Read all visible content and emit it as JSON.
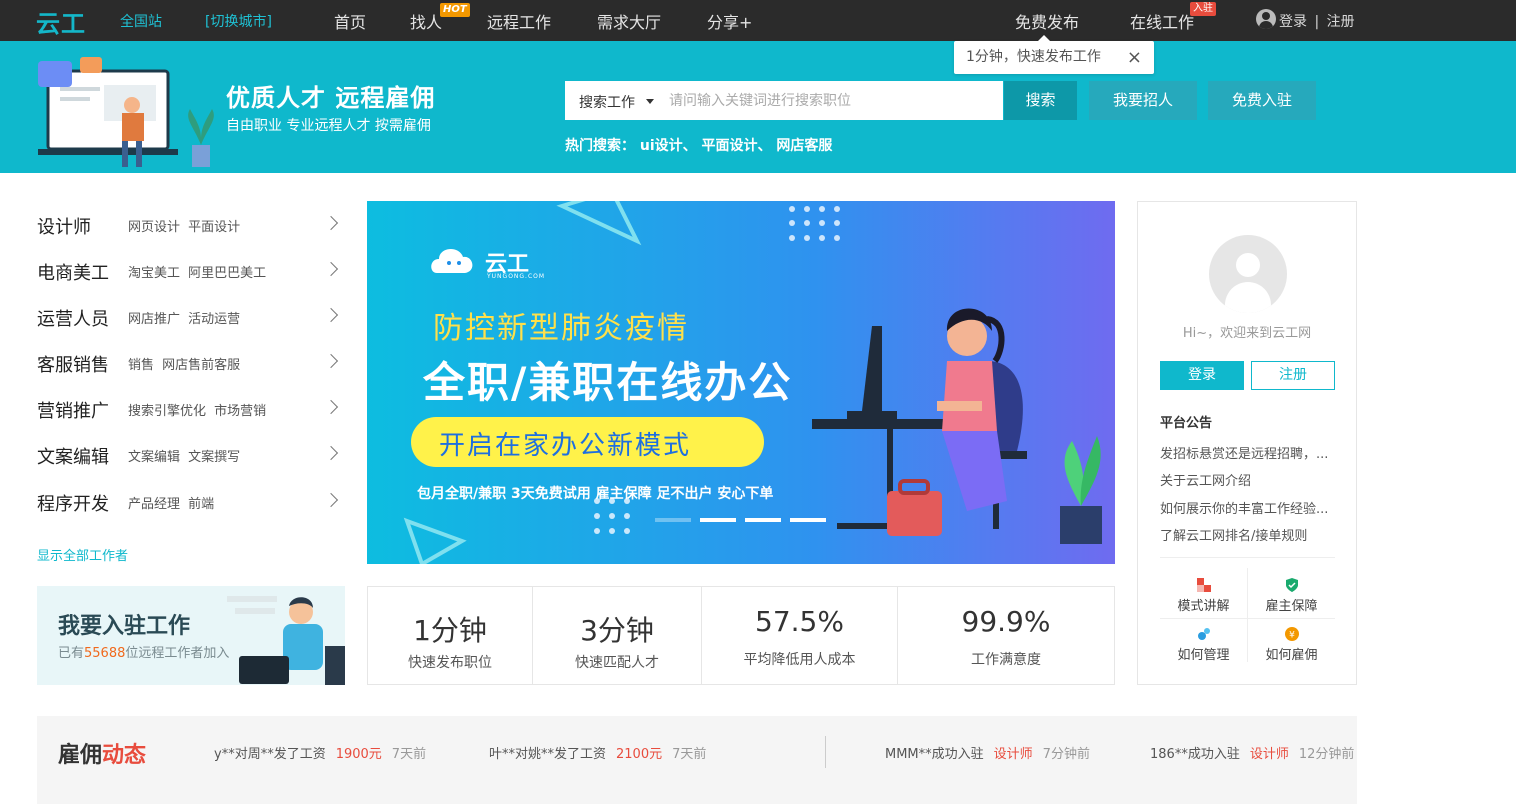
{
  "topnav": {
    "logo": "云工",
    "site": "全国站",
    "switch_city": "[切换城市]",
    "items": [
      "首页",
      "找人",
      "远程工作",
      "需求大厅",
      "分享+"
    ],
    "hot_badge": "HOT",
    "free_post": "免费发布",
    "online_work": "在线工作",
    "ruzhu_badge": "入驻",
    "login": "登录",
    "separator": "|",
    "register": "注册"
  },
  "tooltip": {
    "text": "1分钟，快速发布工作",
    "close": "×"
  },
  "header": {
    "slogan": "优质人才 远程雇佣",
    "subslogan": "自由职业 专业远程人才 按需雇佣",
    "search_type": "搜索工作",
    "search_placeholder": "请问输入关键词进行搜索职位",
    "search_button": "搜索",
    "hire_button": "我要招人",
    "join_button": "免费入驻",
    "hot_search": "热门搜索： ui设计、 平面设计、 网店客服"
  },
  "categories": [
    {
      "title": "设计师",
      "tags": "网页设计 平面设计"
    },
    {
      "title": "电商美工",
      "tags": "淘宝美工 阿里巴巴美工"
    },
    {
      "title": "运营人员",
      "tags": "网店推广 活动运营"
    },
    {
      "title": "客服销售",
      "tags": "销售 网店售前客服"
    },
    {
      "title": "营销推广",
      "tags": "搜索引擎优化 市场营销"
    },
    {
      "title": "文案编辑",
      "tags": "文案编辑 文案撰写"
    },
    {
      "title": "程序开发",
      "tags": "产品经理 前端"
    }
  ],
  "show_all": "显示全部工作者",
  "promo": {
    "title": "我要入驻工作",
    "prefix": "已有",
    "count": "55688",
    "suffix": "位远程工作者加入"
  },
  "banner": {
    "logo": "云工",
    "logo_sub": "YUNGONG.COM",
    "line1": "防控新型肺炎疫情",
    "line2": "全职/兼职在线办公",
    "pill": "开启在家办公新模式",
    "features": "包月全职/兼职  3天免费试用  雇主保障  足不出户  安心下单",
    "slide_count": 4,
    "active_slide": 1
  },
  "stats": [
    {
      "big": "1分钟",
      "small": "快速发布职位"
    },
    {
      "big": "3分钟",
      "small": "快速匹配人才"
    },
    {
      "big": "57.5%",
      "small": "平均降低用人成本"
    },
    {
      "big": "99.9%",
      "small": "工作满意度"
    }
  ],
  "panel": {
    "welcome": "Hi~，欢迎来到云工网",
    "login": "登录",
    "register": "注册",
    "notice_title": "平台公告",
    "notices": [
      "发招标悬赏还是远程招聘，...",
      "关于云工网介绍",
      "如何展示你的丰富工作经验...",
      "了解云工网排名/接单规则"
    ],
    "grid": [
      "模式讲解",
      "雇主保障",
      "如何管理",
      "如何雇佣"
    ]
  },
  "ticker": {
    "title_a": "雇佣",
    "title_b": "动态",
    "items": [
      {
        "who": "y**对周**发了工资",
        "amount": "1900元",
        "time": "7天前"
      },
      {
        "who": "叶**对姚**发了工资",
        "amount": "2100元",
        "time": "7天前"
      },
      {
        "who": "MMM**成功入驻",
        "amount": "设计师",
        "time": "7分钟前"
      },
      {
        "who": "186**成功入驻",
        "amount": "设计师",
        "time": "12分钟前"
      }
    ]
  },
  "colors": {
    "brand": "#0fb8cc",
    "dark": "#2b2b2b",
    "hot": "#f39800",
    "accent_red": "#e84c3d",
    "highlight_yellow": "#fff24a"
  }
}
